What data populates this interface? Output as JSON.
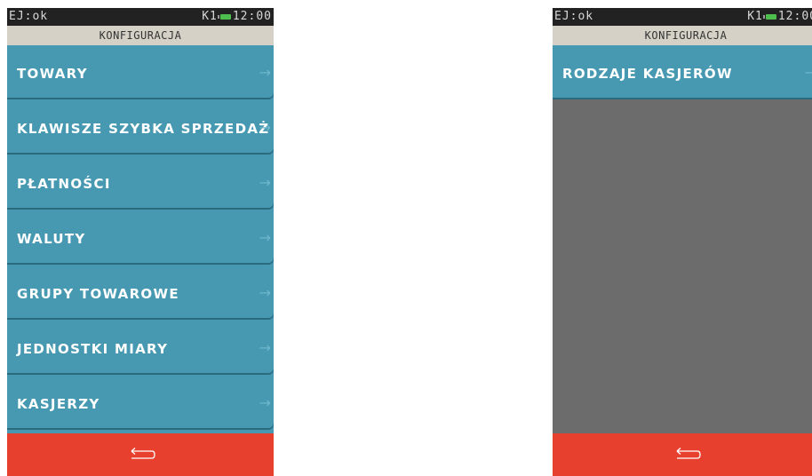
{
  "screens": [
    {
      "status": {
        "ej": "EJ:ok",
        "k1": "K1",
        "time": "12:00"
      },
      "header": "KONFIGURACJA",
      "menu_items": [
        "TOWARY",
        "KLAWISZE SZYBKA SPRZEDAŻ",
        "PŁATNOŚCI",
        "WALUTY",
        "GRUPY TOWAROWE",
        "JEDNOSTKI MIARY",
        "KASJERZY"
      ],
      "arrow": "→"
    },
    {
      "status": {
        "ej": "EJ:ok",
        "k1": "K1",
        "time": "12:00"
      },
      "header": "KONFIGURACJA",
      "menu_items": [
        "RODZAJE KASJERÓW"
      ],
      "arrow": "→"
    }
  ],
  "icons": {
    "back": "back-arrow-icon",
    "battery": "battery-icon"
  },
  "colors": {
    "menu_item": "#4799b2",
    "footer": "#e8402f",
    "header": "#d6d1c6",
    "status_bar": "#222222",
    "empty_area": "#6c6c6c"
  }
}
